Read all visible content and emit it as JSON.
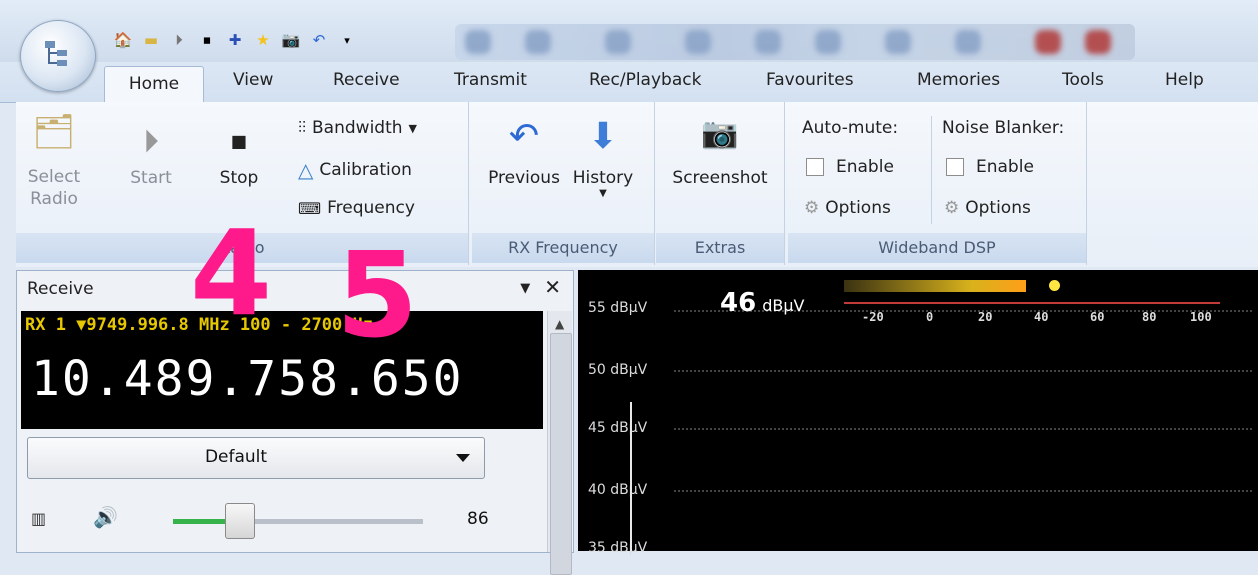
{
  "ribbon_tabs": [
    "Home",
    "View",
    "Receive",
    "Transmit",
    "Rec/Playback",
    "Favourites",
    "Memories",
    "Tools",
    "Help"
  ],
  "groups": {
    "radio": {
      "label": "Radio",
      "select_radio": "Select\nRadio",
      "start": "Start",
      "stop": "Stop",
      "bandwidth": "Bandwidth",
      "calibration": "Calibration",
      "frequency": "Frequency"
    },
    "rx_frequency": {
      "label": "RX Frequency",
      "previous": "Previous",
      "history": "History"
    },
    "extras": {
      "label": "Extras",
      "screenshot": "Screenshot"
    },
    "wideband_dsp": {
      "label": "Wideband DSP",
      "auto_mute": "Auto-mute:",
      "noise_blanker": "Noise Blanker:",
      "enable": "Enable",
      "options": "Options"
    }
  },
  "receive_panel": {
    "title": "Receive",
    "rx_line": "RX 1 ▼9749.996.8 MHz    100 - 2700 Hz",
    "frequency": "10.489.758.650",
    "mode": "Default",
    "volume_value": "86",
    "volume_fraction": 0.22
  },
  "spectrum": {
    "level": "46",
    "level_unit": "dBµV",
    "y_labels": [
      "55 dBµV",
      "50 dBµV",
      "45 dBµV",
      "40 dBµV",
      "35 dBµV"
    ],
    "meter_ticks": [
      "-20",
      "0",
      "20",
      "40",
      "60",
      "80",
      "100"
    ]
  },
  "annotations": [
    "4",
    "5"
  ],
  "colors": {
    "annotation": "#ff1a8c",
    "freq_text": "#ffffff",
    "rx_line": "#e6c700",
    "meter_line": "#c23b3b"
  }
}
